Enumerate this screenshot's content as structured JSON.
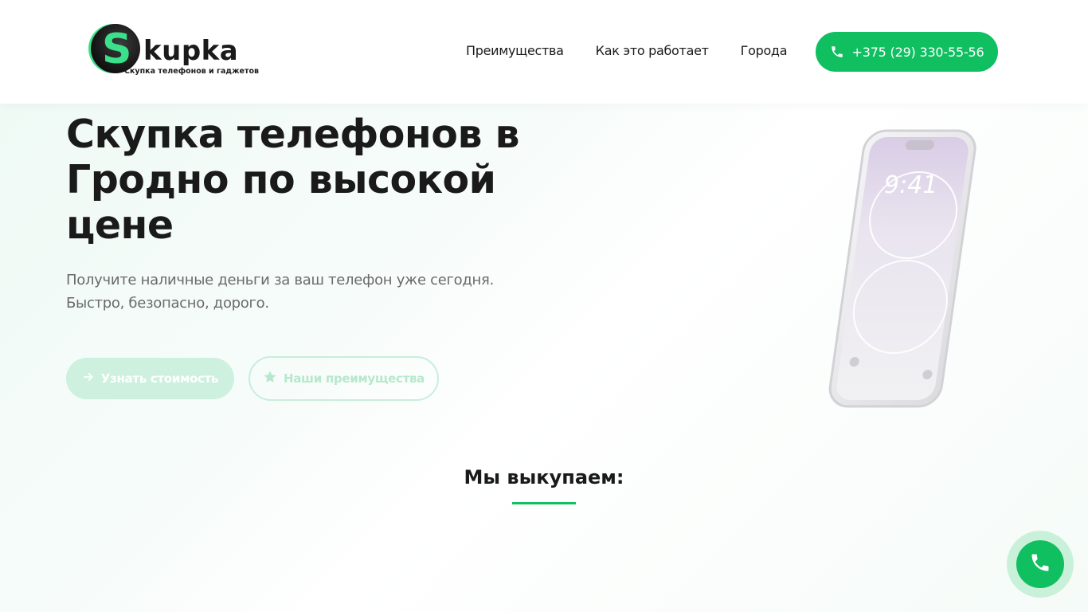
{
  "header": {
    "logo": {
      "letter": "S",
      "word": "kupka",
      "tagline": "Скупка телефонов и гаджетов"
    },
    "nav": [
      {
        "label": "Преимущества"
      },
      {
        "label": "Как это работает"
      },
      {
        "label": "Города"
      }
    ],
    "phone_button": {
      "label": "+375 (29) 330-55-56",
      "icon": "phone-icon"
    }
  },
  "hero": {
    "title": "Скупка телефонов в Гродно по высокой цене",
    "subtitle_line1": "Получите наличные деньги за ваш телефон уже сегодня.",
    "subtitle_line2": "Быстро, безопасно, дорого.",
    "primary_button": {
      "label": "Узнать стоимость",
      "icon": "arrow-right-icon"
    },
    "secondary_button": {
      "label": "Наши преимущества",
      "icon": "star-icon"
    },
    "phone_image": {
      "time": "9:41"
    }
  },
  "section": {
    "title": "Мы выкупаем:"
  },
  "floating_call": {
    "icon": "phone-icon"
  },
  "colors": {
    "accent": "#0fbf60",
    "accent_light": "#cdf1de",
    "logo_green": "#3be08a"
  }
}
